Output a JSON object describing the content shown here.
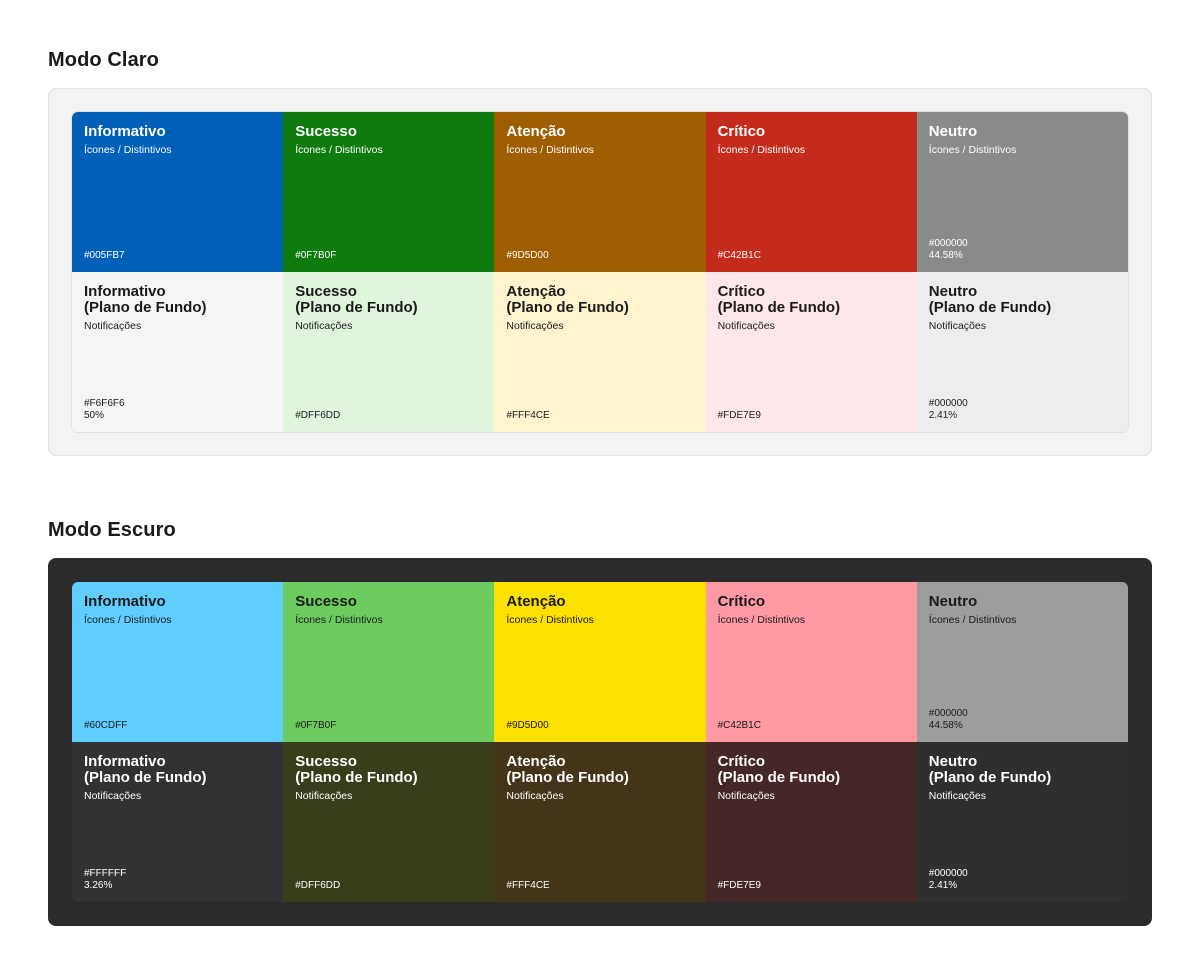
{
  "sections": [
    {
      "title": "Modo Claro",
      "rows": [
        [
          {
            "title": [
              "Informativo"
            ],
            "subtitle": "Ícones / Distintivos",
            "hex": "#005FB7",
            "opacity": "",
            "bg": "#005FB7",
            "fg": "#ffffff"
          },
          {
            "title": [
              "Sucesso"
            ],
            "subtitle": "Ícones / Distintivos",
            "hex": "#0F7B0F",
            "opacity": "",
            "bg": "#0F7B0F",
            "fg": "#ffffff"
          },
          {
            "title": [
              "Atenção"
            ],
            "subtitle": "Ícones / Distintivos",
            "hex": "#9D5D00",
            "opacity": "",
            "bg": "#9D5D00",
            "fg": "#ffffff"
          },
          {
            "title": [
              "Crítico"
            ],
            "subtitle": "Ícones / Distintivos",
            "hex": "#C42B1C",
            "opacity": "",
            "bg": "#C42B1C",
            "fg": "#ffffff"
          },
          {
            "title": [
              "Neutro"
            ],
            "subtitle": "Ícones / Distintivos",
            "hex": "#000000",
            "opacity": "44.58%",
            "bg": "#8A8A8A",
            "fg": "#ffffff"
          }
        ],
        [
          {
            "title": [
              "Informativo",
              "(Plano de Fundo)"
            ],
            "subtitle": "Notificações",
            "hex": "#F6F6F6",
            "opacity": "50%",
            "bg": "#F5F5F5",
            "fg": "#1a1a1a"
          },
          {
            "title": [
              "Sucesso",
              "(Plano de Fundo)"
            ],
            "subtitle": "Notificações",
            "hex": "#DFF6DD",
            "opacity": "",
            "bg": "#DFF6DD",
            "fg": "#1a1a1a"
          },
          {
            "title": [
              "Atenção",
              "(Plano de Fundo)"
            ],
            "subtitle": "Notificações",
            "hex": "#FFF4CE",
            "opacity": "",
            "bg": "#FFF4CE",
            "fg": "#1a1a1a"
          },
          {
            "title": [
              "Crítico",
              "(Plano de Fundo)"
            ],
            "subtitle": "Notificações",
            "hex": "#FDE7E9",
            "opacity": "",
            "bg": "#FDE7E9",
            "fg": "#1a1a1a"
          },
          {
            "title": [
              "Neutro",
              "(Plano de Fundo)"
            ],
            "subtitle": "Notificações",
            "hex": "#000000",
            "opacity": "2.41%",
            "bg": "#EDEDED",
            "fg": "#1a1a1a"
          }
        ]
      ]
    },
    {
      "title": "Modo Escuro",
      "rows": [
        [
          {
            "title": [
              "Informativo"
            ],
            "subtitle": "Ícones / Distintivos",
            "hex": "#60CDFF",
            "opacity": "",
            "bg": "#60CDFF",
            "fg": "#1a1a1a"
          },
          {
            "title": [
              "Sucesso"
            ],
            "subtitle": "Ícones / Distintivos",
            "hex": "#0F7B0F",
            "opacity": "",
            "bg": "#6CCB5F",
            "fg": "#1a1a1a"
          },
          {
            "title": [
              "Atenção"
            ],
            "subtitle": "Ícones / Distintivos",
            "hex": "#9D5D00",
            "opacity": "",
            "bg": "#FCE100",
            "fg": "#1a1a1a"
          },
          {
            "title": [
              "Crítico"
            ],
            "subtitle": "Ícones / Distintivos",
            "hex": "#C42B1C",
            "opacity": "",
            "bg": "#FF99A4",
            "fg": "#1a1a1a"
          },
          {
            "title": [
              "Neutro"
            ],
            "subtitle": "Ícones / Distintivos",
            "hex": "#000000",
            "opacity": "44.58%",
            "bg": "#9D9D9D",
            "fg": "#1a1a1a"
          }
        ],
        [
          {
            "title": [
              "Informativo",
              "(Plano de Fundo)"
            ],
            "subtitle": "Notificações",
            "hex": "#FFFFFF",
            "opacity": "3.26%",
            "bg": "#323232",
            "fg": "#ffffff"
          },
          {
            "title": [
              "Sucesso",
              "(Plano de Fundo)"
            ],
            "subtitle": "Notificações",
            "hex": "#DFF6DD",
            "opacity": "",
            "bg": "#393D1B",
            "fg": "#ffffff"
          },
          {
            "title": [
              "Atenção",
              "(Plano de Fundo)"
            ],
            "subtitle": "Notificações",
            "hex": "#FFF4CE",
            "opacity": "",
            "bg": "#433519",
            "fg": "#ffffff"
          },
          {
            "title": [
              "Crítico",
              "(Plano de Fundo)"
            ],
            "subtitle": "Notificações",
            "hex": "#FDE7E9",
            "opacity": "",
            "bg": "#442726",
            "fg": "#ffffff"
          },
          {
            "title": [
              "Neutro",
              "(Plano de Fundo)"
            ],
            "subtitle": "Notificações",
            "hex": "#000000",
            "opacity": "2.41%",
            "bg": "#2F2F2F",
            "fg": "#ffffff"
          }
        ]
      ]
    }
  ]
}
